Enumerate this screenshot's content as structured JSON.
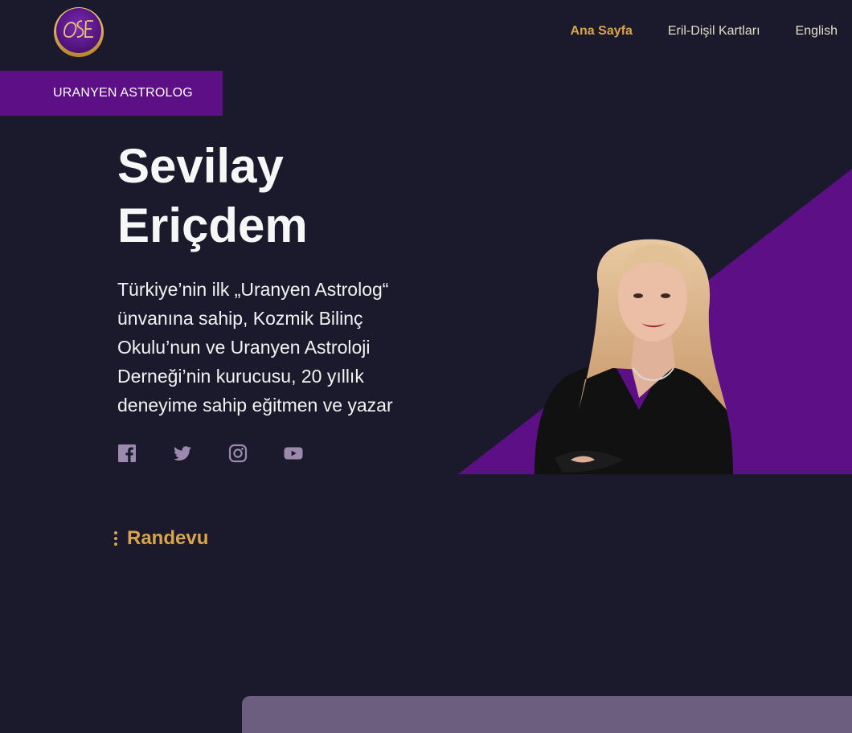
{
  "header": {
    "logo_icon": "ose-monogram-logo",
    "nav": [
      {
        "label": "Ana Sayfa",
        "active": true
      },
      {
        "label": "Eril-Dişil Kartları",
        "active": false
      },
      {
        "label": "English",
        "active": false
      }
    ]
  },
  "hero": {
    "badge": "URANYEN ASTROLOG",
    "name_first": "Sevilay",
    "name_last": "Eriçdem",
    "description": "Türkiye’nin ilk „Uranyen Astrolog“ ünvanına sahip, Kozmik Bilinç Okulu’nun ve Uranyen Astroloji Derneği’nin kurucusu, 20 yıllık deneyime sahip eğitmen ve yazar",
    "social_icons": [
      "facebook-icon",
      "twitter-icon",
      "instagram-icon",
      "youtube-icon"
    ],
    "photo": "portrait-photo"
  },
  "appointment": {
    "title": "Randevu"
  },
  "colors": {
    "background": "#1b1a2c",
    "accent_gold": "#d8a54a",
    "accent_purple": "#5d0f86",
    "social_icon": "#9b8aae",
    "card": "#6b5e7e"
  }
}
